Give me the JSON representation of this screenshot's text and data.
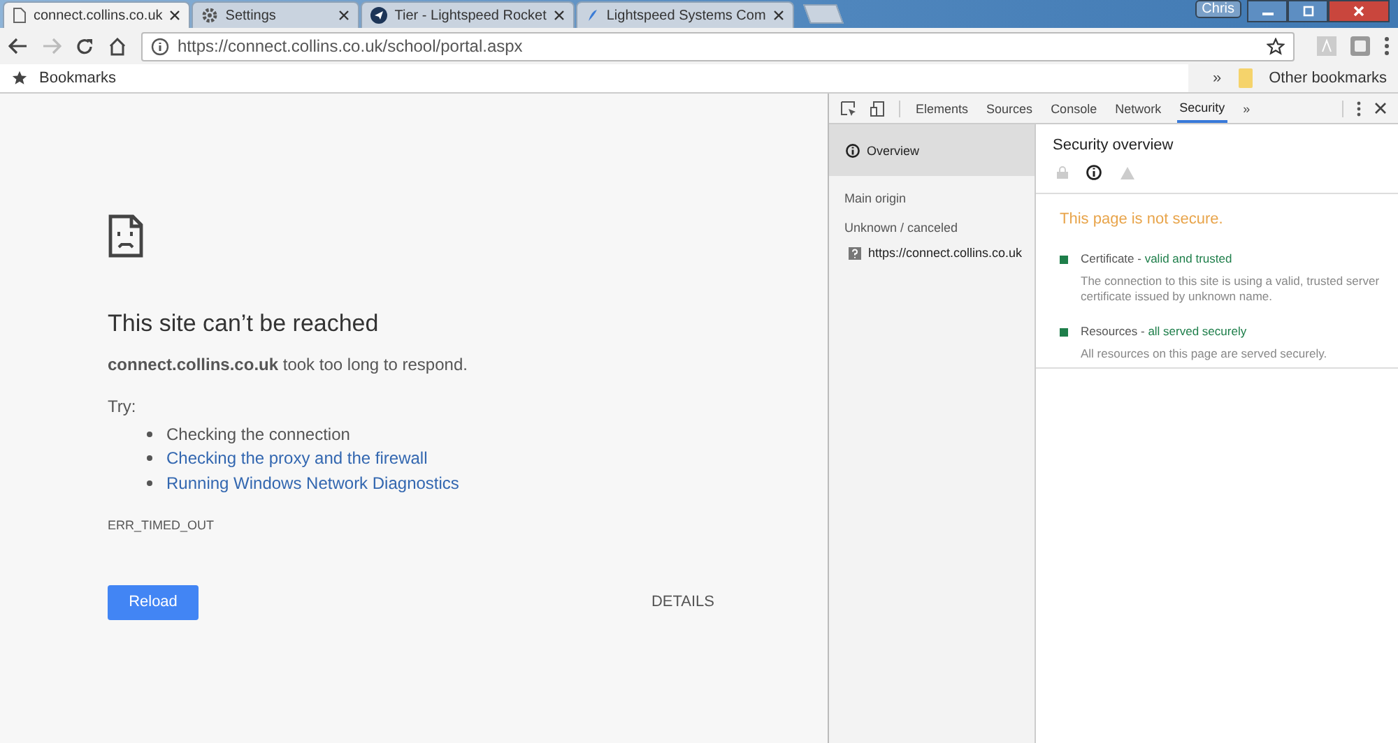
{
  "window": {
    "profile": "Chris"
  },
  "tabs": [
    {
      "title": "connect.collins.co.uk",
      "kind": "page",
      "selected": true
    },
    {
      "title": "Settings",
      "kind": "gear",
      "selected": false
    },
    {
      "title": "Tier - Lightspeed Rocket",
      "kind": "rocket",
      "selected": false
    },
    {
      "title": "Lightspeed Systems Com",
      "kind": "feather",
      "selected": false
    }
  ],
  "toolbar": {
    "url": "https://connect.collins.co.uk/school/portal.aspx"
  },
  "bookmarks_bar": {
    "apps_label": "Bookmarks",
    "overflow": "»",
    "other": "Other bookmarks"
  },
  "error_page": {
    "title": "This site can’t be reached",
    "message": "**connect.collins.co.uk** took too long to respond.",
    "try_label": "Try:",
    "suggestions": [
      {
        "text": "Checking the connection",
        "kind": "text"
      },
      {
        "text": "Checking the proxy and the firewall",
        "kind": "link"
      },
      {
        "text": "Running Windows Network Diagnostics",
        "kind": "link"
      }
    ],
    "code": "ERR_TIMED_OUT",
    "reload": "Reload",
    "details": "DETAILS"
  },
  "devtools": {
    "tabs": [
      {
        "label": "Elements",
        "selected": false
      },
      {
        "label": "Sources",
        "selected": false
      },
      {
        "label": "Console",
        "selected": false
      },
      {
        "label": "Network",
        "selected": false
      },
      {
        "label": "Security",
        "selected": true
      }
    ],
    "more": "»",
    "sidebar": {
      "overview": {
        "label": "Overview",
        "selected": true
      },
      "main_origin": "Main origin",
      "group": "Unknown / canceled",
      "origins": [
        {
          "url": "https://connect.collins.co.uk",
          "selected": false
        }
      ]
    },
    "overview": {
      "title": "Security overview",
      "states": [
        {
          "kind": "secure",
          "selected": false
        },
        {
          "kind": "info",
          "selected": true
        },
        {
          "kind": "warning",
          "selected": false
        }
      ],
      "summary": "This page is not secure.",
      "items": [
        {
          "label": "Certificate -",
          "status": "valid and trusted",
          "description": "The connection to this site is using a valid, trusted server certificate issued by unknown name.",
          "color": "#1e7e4a"
        },
        {
          "label": "Resources -",
          "status": "all served securely",
          "description": "All resources on this page are served securely.",
          "color": "#1e7e4a"
        }
      ]
    }
  }
}
